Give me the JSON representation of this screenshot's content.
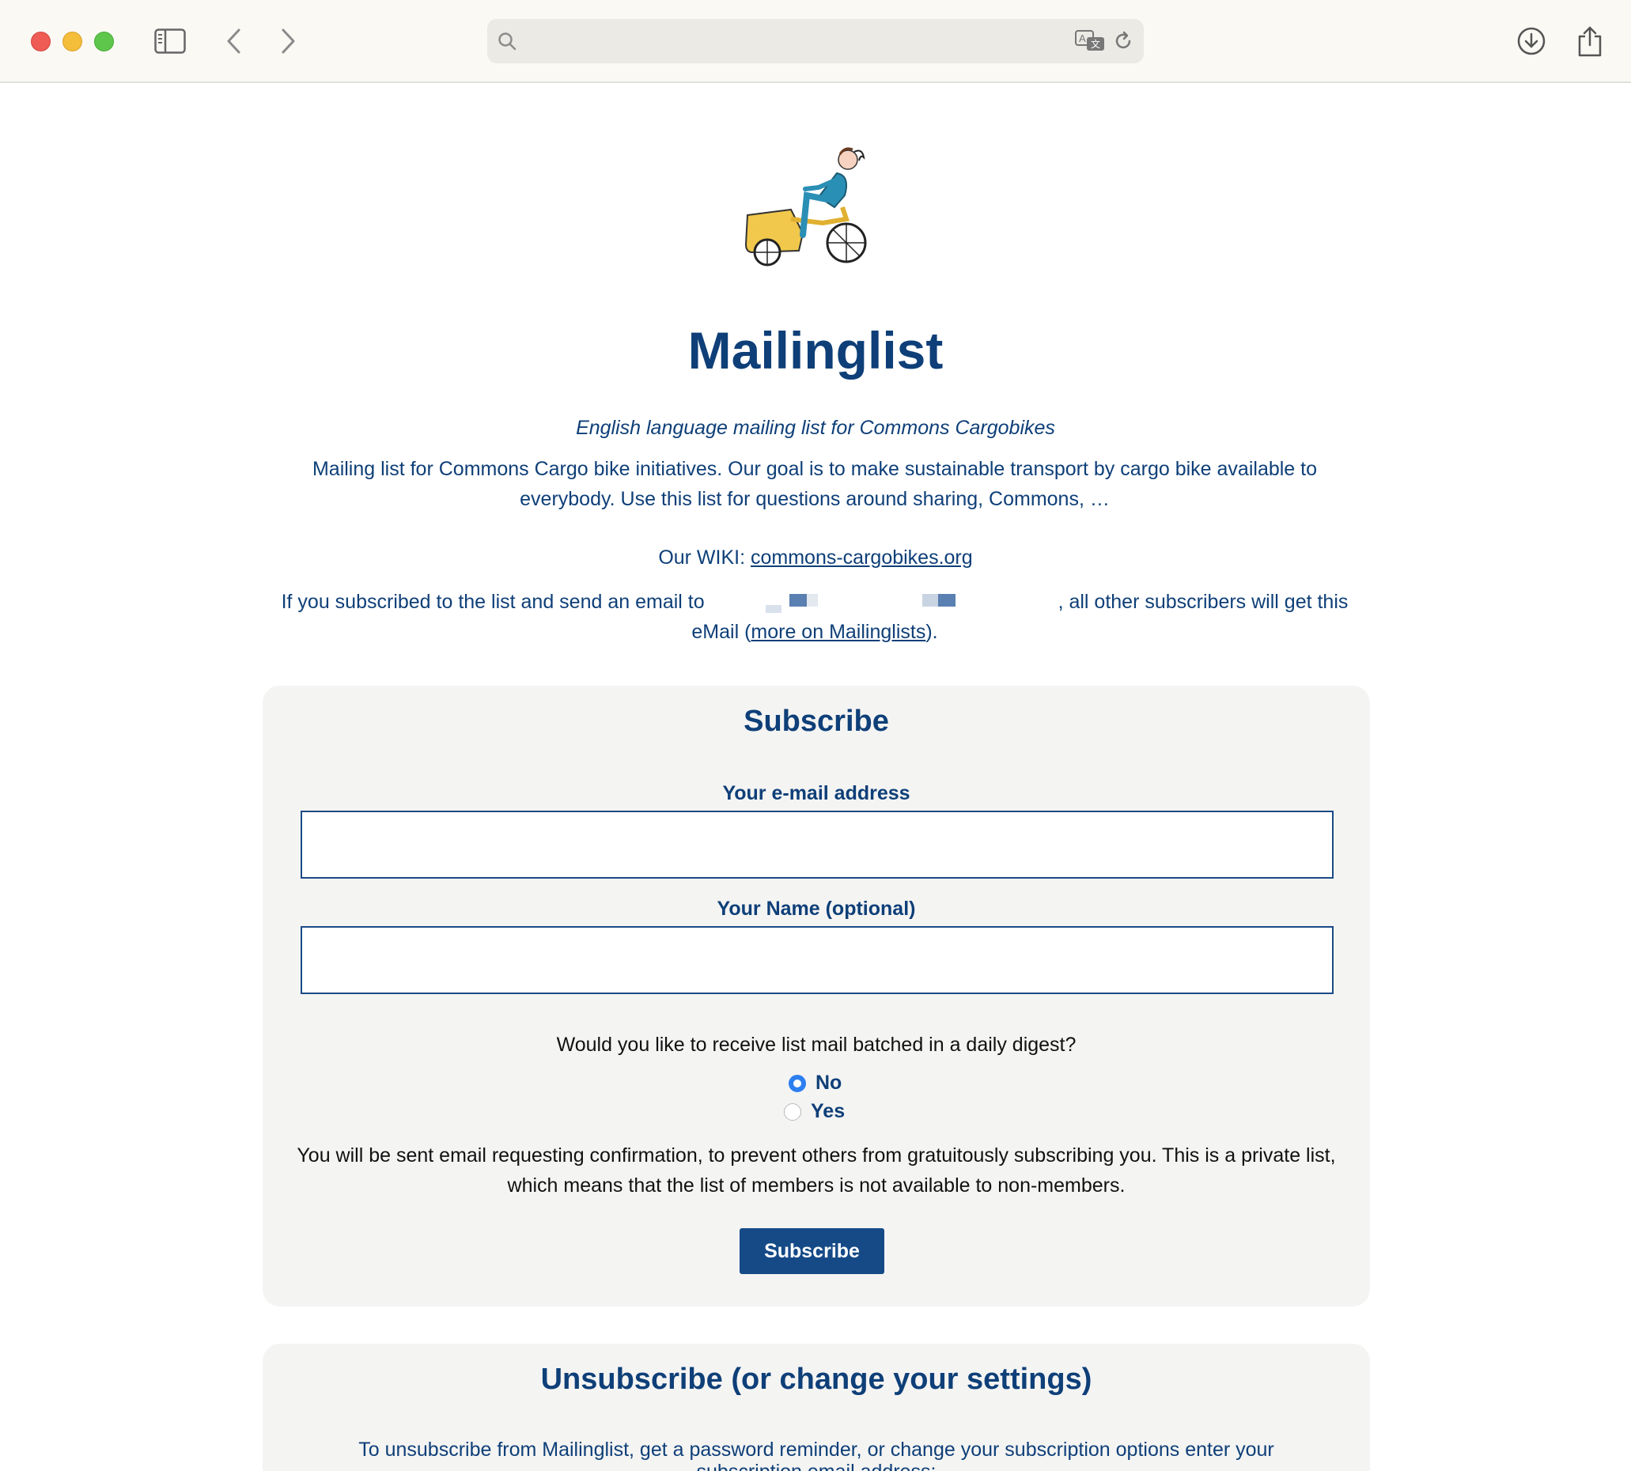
{
  "browser": {
    "toolbar_icons": [
      "sidebar-icon",
      "back-icon",
      "forward-icon",
      "search-icon",
      "translate-icon",
      "reload-icon",
      "download-icon",
      "share-icon"
    ],
    "url": ""
  },
  "page": {
    "title": "Mailinglist",
    "tagline": "English language mailing list for Commons Cargobikes",
    "description": "Mailing list for Commons Cargo bike initiatives. Our goal is to make sustainable transport by cargo bike available to everybody. Use this list for questions around sharing, Commons, …",
    "wiki_prefix": "Our WIKI: ",
    "wiki_link": "commons-cargobikes.org",
    "info_prefix": "If you subscribed to the list and send an email to ",
    "info_suffix": ", all other subscribers will get this eMail (",
    "info_link": "more on Mailinglists",
    "info_end": ")."
  },
  "subscribe": {
    "heading": "Subscribe",
    "email_label": "Your e-mail address",
    "email_value": "",
    "name_label": "Your Name (optional)",
    "name_value": "",
    "digest_question": "Would you like to receive list mail batched in a daily digest?",
    "digest_options": [
      {
        "label": "No",
        "selected": true
      },
      {
        "label": "Yes",
        "selected": false
      }
    ],
    "confirmation_note": "You will be sent email requesting confirmation, to prevent others from gratuitously subscribing you. This is a private list, which means that the list of members is not available to non-members.",
    "button_label": "Subscribe"
  },
  "unsubscribe": {
    "heading": "Unsubscribe (or change your settings)",
    "text": "To unsubscribe from Mailinglist, get a password reminder, or change your subscription options enter your subscription email address:"
  },
  "colors": {
    "text_blue": "#0e3f78",
    "button_blue": "#154a87",
    "card_bg": "#f4f4f3",
    "radio_selected": "#2d7ff0"
  }
}
